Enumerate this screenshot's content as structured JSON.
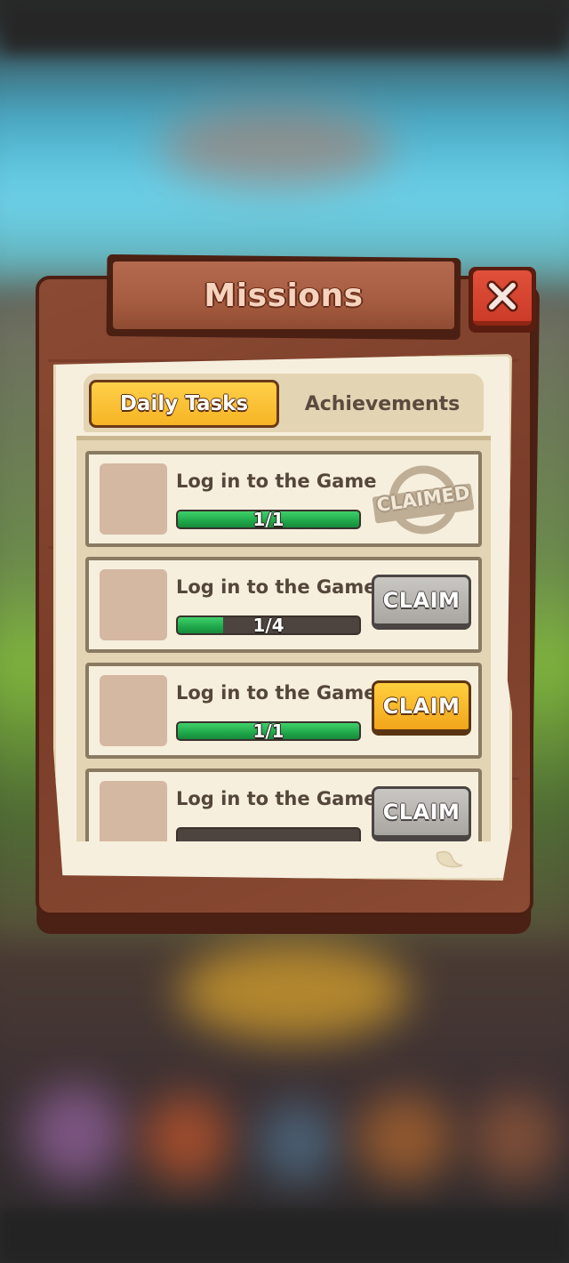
{
  "title": "Missions",
  "close_icon": "close-x-icon",
  "tabs": [
    {
      "label": "Daily Tasks",
      "active": true
    },
    {
      "label": "Achievements",
      "active": false
    }
  ],
  "colors": {
    "wood": "#7a3d29",
    "paper": "#f6efdd",
    "tab_active": "#f6b424",
    "progress_fill": "#1fa84a",
    "button_gold": "#f2a51b",
    "button_gray": "#a9a6a1",
    "close_red": "#cc3b28"
  },
  "tasks": [
    {
      "label": "Log in to the Game",
      "progress_text": "1/1",
      "progress": 1.0,
      "status": "claimed",
      "action_label": "CLAIMED"
    },
    {
      "label": "Log in to the Game",
      "progress_text": "1/4",
      "progress": 0.25,
      "status": "locked",
      "action_label": "CLAIM"
    },
    {
      "label": "Log in to the Game",
      "progress_text": "1/1",
      "progress": 1.0,
      "status": "claimable",
      "action_label": "CLAIM"
    },
    {
      "label": "Log in to the Game",
      "progress_text": "",
      "progress": 0,
      "status": "locked",
      "action_label": "CLAIM"
    }
  ]
}
